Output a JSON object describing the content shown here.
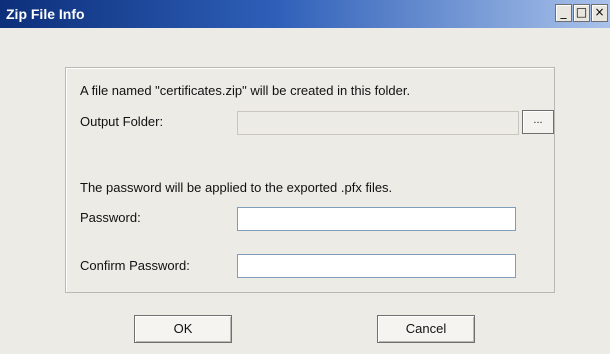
{
  "window": {
    "title": "Zip File Info",
    "controls": {
      "minimize": "_",
      "maximize": "□",
      "close": "×"
    }
  },
  "form": {
    "info_text": "A file named \"certificates.zip\" will be created in this folder.",
    "output_folder_label": "Output Folder:",
    "output_folder_value": "",
    "browse_label": "...",
    "password_info_text": "The password will be applied to the exported .pfx files.",
    "password_label": "Password:",
    "password_value": "",
    "confirm_password_label": "Confirm Password:",
    "confirm_password_value": ""
  },
  "buttons": {
    "ok_label": "OK",
    "cancel_label": "Cancel"
  }
}
